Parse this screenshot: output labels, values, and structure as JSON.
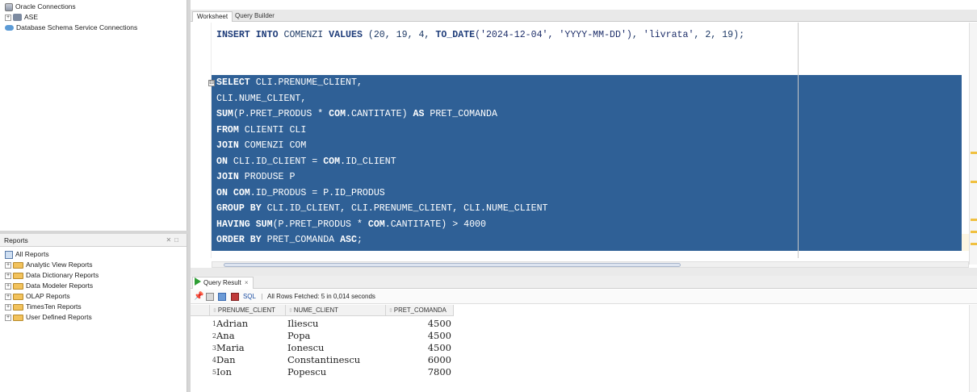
{
  "connections": {
    "items": [
      {
        "label": "Oracle Connections"
      },
      {
        "label": "ASE"
      },
      {
        "label": "Database Schema Service Connections"
      }
    ]
  },
  "reports": {
    "header": "Reports",
    "items": [
      {
        "label": "All Reports"
      },
      {
        "label": "Analytic View Reports"
      },
      {
        "label": "Data Dictionary Reports"
      },
      {
        "label": "Data Modeler Reports"
      },
      {
        "label": "OLAP Reports"
      },
      {
        "label": "TimesTen Reports"
      },
      {
        "label": "User Defined Reports"
      }
    ]
  },
  "editor_tabs": {
    "worksheet": "Worksheet",
    "query_builder": "Query Builder"
  },
  "editor": {
    "insert_line": {
      "kw1": "INSERT INTO",
      "t1": " COMENZI ",
      "kw2": "VALUES",
      "t2": " (20, 19, 4, ",
      "kw3": "TO_DATE",
      "s1": "('2024-12-04', 'YYYY-MM-DD')",
      "t3": ", ",
      "s2": "'livrata'",
      "t4": ", 2, 19);"
    },
    "select_lines": [
      {
        "kw": "SELECT",
        "rest": " CLI.PRENUME_CLIENT,"
      },
      {
        "kw": "",
        "rest": "CLI.NUME_CLIENT,"
      },
      {
        "kw": "SUM",
        "rest": "(P.PRET_PRODUS * ",
        "kw2": "COM",
        "rest2": ".CANTITATE) ",
        "kw3": "AS",
        "rest3": " PRET_COMANDA"
      },
      {
        "kw": "FROM",
        "rest": " CLIENTI CLI"
      },
      {
        "kw": "JOIN",
        "rest": " COMENZI COM"
      },
      {
        "kw": "ON",
        "rest": " CLI.ID_CLIENT = ",
        "kw2": "COM",
        "rest2": ".ID_CLIENT"
      },
      {
        "kw": "JOIN",
        "rest": " PRODUSE P"
      },
      {
        "kw": "ON",
        "rest": " ",
        "kw2": "COM",
        "rest2": ".ID_PRODUS = P.ID_PRODUS"
      },
      {
        "kw": "GROUP BY",
        "rest": " CLI.ID_CLIENT, CLI.PRENUME_CLIENT, CLI.NUME_CLIENT"
      },
      {
        "kw": "HAVING SUM",
        "rest": "(P.PRET_PRODUS * ",
        "kw2": "COM",
        "rest2": ".CANTITATE) > 4000"
      },
      {
        "kw": "ORDER BY",
        "rest": " PRET_COMANDA ",
        "kw2": "ASC",
        "rest2": ";"
      }
    ],
    "fold_glyph": "⊟"
  },
  "results": {
    "tab_label": "Query Result",
    "tab_close": "×",
    "toolbar": {
      "sql_label": "SQL",
      "separator": "|",
      "status": "All Rows Fetched: 5 in 0,014 seconds"
    },
    "columns": [
      "PRENUME_CLIENT",
      "NUME_CLIENT",
      "PRET_COMANDA"
    ],
    "rows": [
      {
        "n": "1",
        "prenume": "Adrian",
        "nume": "Iliescu",
        "pret": "4500"
      },
      {
        "n": "2",
        "prenume": "Ana",
        "nume": "Popa",
        "pret": "4500"
      },
      {
        "n": "3",
        "prenume": "Maria",
        "nume": "Ionescu",
        "pret": "4500"
      },
      {
        "n": "4",
        "prenume": "Dan",
        "nume": "Constantinescu",
        "pret": "6000"
      },
      {
        "n": "5",
        "prenume": "Ion",
        "nume": "Popescu",
        "pret": "7800"
      }
    ]
  }
}
